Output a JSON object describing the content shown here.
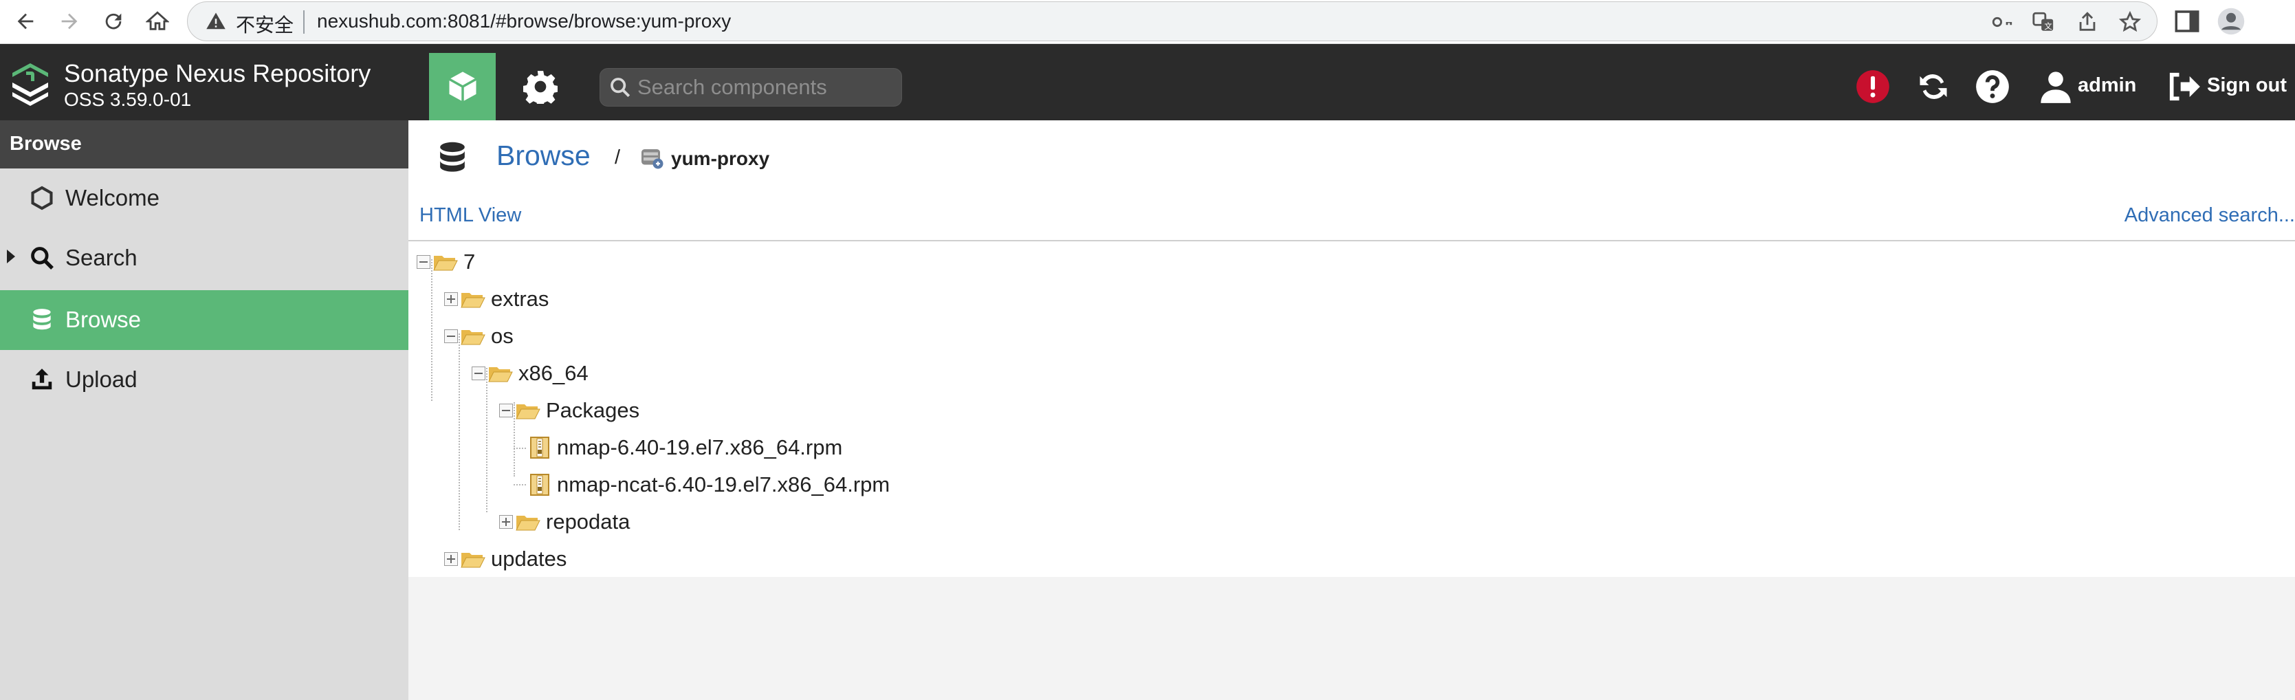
{
  "browser": {
    "insecure_label": "不安全",
    "url": "nexushub.com:8081/#browse/browse:yum-proxy"
  },
  "header": {
    "brand_title": "Sonatype Nexus Repository",
    "brand_version": "OSS 3.59.0-01",
    "search_placeholder": "Search components",
    "user_name": "admin",
    "sign_out": "Sign out",
    "accent_color": "#5bb878",
    "alert_color": "#c8102e"
  },
  "sidebar": {
    "section_title": "Browse",
    "items": [
      {
        "label": "Welcome",
        "icon": "hexagon-icon",
        "active": false
      },
      {
        "label": "Search",
        "icon": "search-icon",
        "active": false,
        "expandable": true
      },
      {
        "label": "Browse",
        "icon": "database-icon",
        "active": true
      },
      {
        "label": "Upload",
        "icon": "upload-icon",
        "active": false
      }
    ]
  },
  "main": {
    "breadcrumb_title": "Browse",
    "breadcrumb_separator": "/",
    "repository": "yum-proxy",
    "html_view": "HTML View",
    "advanced_search": "Advanced search..."
  },
  "tree": [
    {
      "label": "7",
      "type": "folder",
      "expanded": true,
      "depth": 0
    },
    {
      "label": "extras",
      "type": "folder",
      "expanded": false,
      "depth": 1
    },
    {
      "label": "os",
      "type": "folder",
      "expanded": true,
      "depth": 1
    },
    {
      "label": "x86_64",
      "type": "folder",
      "expanded": true,
      "depth": 2
    },
    {
      "label": "Packages",
      "type": "folder",
      "expanded": true,
      "depth": 3
    },
    {
      "label": "nmap-6.40-19.el7.x86_64.rpm",
      "type": "file",
      "depth": 4
    },
    {
      "label": "nmap-ncat-6.40-19.el7.x86_64.rpm",
      "type": "file",
      "depth": 4
    },
    {
      "label": "repodata",
      "type": "folder",
      "expanded": false,
      "depth": 3
    },
    {
      "label": "updates",
      "type": "folder",
      "expanded": false,
      "depth": 1
    }
  ]
}
